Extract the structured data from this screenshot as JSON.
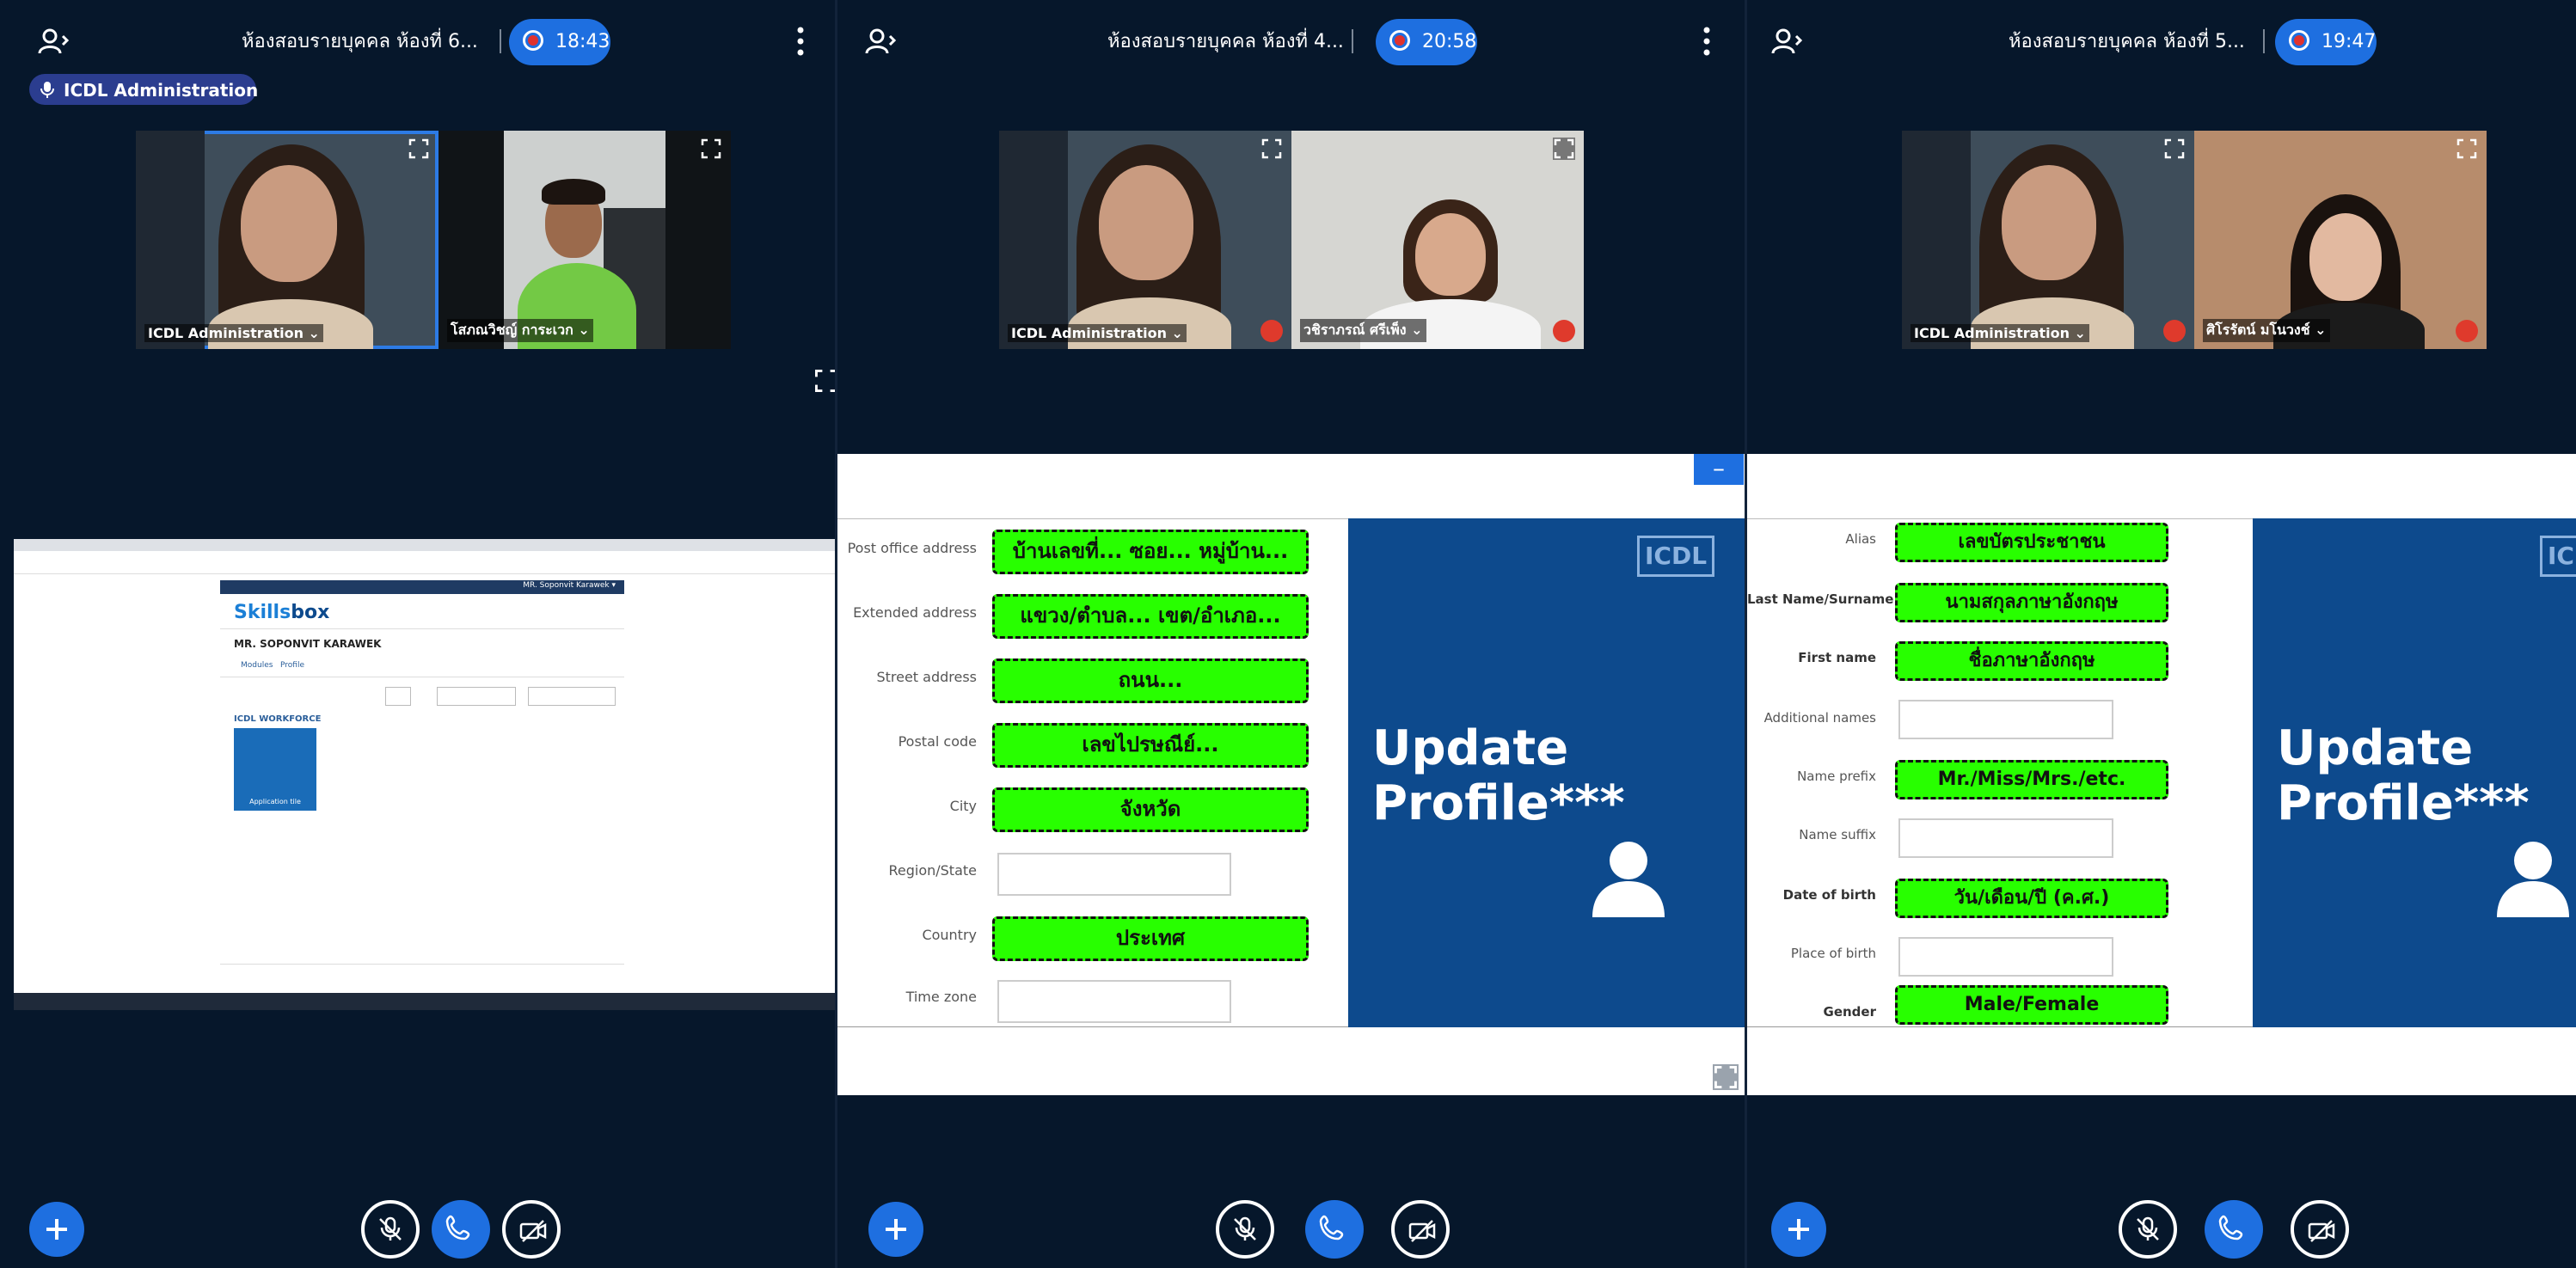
{
  "panels": [
    {
      "title": "ห้องสอบรายบุคคล ห้องที่ 6...",
      "recording_time": "18:43",
      "talking_indicator": "ICDL Administration",
      "videos": [
        {
          "name": "ICDL Administration ⌄"
        },
        {
          "name": "โสภณวิชญ์ การะเวก ⌄"
        }
      ],
      "screenshare": {
        "header_user": "MR. Soponvit Karawek ▾",
        "logo_a": "Skills",
        "logo_b": "box",
        "username": "MR. SOPONVIT KARAWEK",
        "nav": [
          "Modules",
          "Profile"
        ],
        "section": "ICDL WORKFORCE",
        "tile_label": "Application tile"
      }
    },
    {
      "title": "ห้องสอบรายบุคคล ห้องที่ 4...",
      "recording_time": "20:58",
      "videos": [
        {
          "name": "ICDL Administration ⌄"
        },
        {
          "name": "วชิราภรณ์ ศรีเพ็ง ⌄"
        }
      ],
      "slide": {
        "rows": [
          {
            "label": "Post office address",
            "value": "บ้านเลขที่... ซอย... หมู่บ้าน..."
          },
          {
            "label": "Extended address",
            "value": "แขวง/ตำบล... เขต/อำเภอ..."
          },
          {
            "label": "Street address",
            "value": "ถนน..."
          },
          {
            "label": "Postal code",
            "value": "เลขไปรษณีย์..."
          },
          {
            "label": "City",
            "value": "จังหวัด"
          },
          {
            "label": "Region/State",
            "value": ""
          },
          {
            "label": "Country",
            "value": "ประเทศ"
          },
          {
            "label": "Time zone",
            "value": ""
          }
        ],
        "headline_1": "Update",
        "headline_2": "Profile***",
        "logo": "ICDL",
        "minimize": "–"
      }
    },
    {
      "title": "ห้องสอบรายบุคคล ห้องที่ 5...",
      "recording_time": "19:47",
      "videos": [
        {
          "name": "ICDL Administration ⌄"
        },
        {
          "name": "ศิโรรัตน์ มโนวงช์ ⌄"
        }
      ],
      "slide": {
        "rows": [
          {
            "label": "Alias",
            "value": "เลขบัตรประชาชน"
          },
          {
            "label": "Last Name/Surname",
            "value": "นามสกุลภาษาอังกฤษ"
          },
          {
            "label": "First name",
            "value": "ชื่อภาษาอังกฤษ"
          },
          {
            "label": "Additional names",
            "value": ""
          },
          {
            "label": "Name prefix",
            "value": "Mr./Miss/Mrs./etc."
          },
          {
            "label": "Name suffix",
            "value": ""
          },
          {
            "label": "Date of birth",
            "value": "วัน/เดือน/ปี (ค.ศ.)"
          },
          {
            "label": "Place of birth",
            "value": ""
          },
          {
            "label": "Gender",
            "value": "Male/Female"
          }
        ],
        "headline_1": "Update",
        "headline_2": "Profile***",
        "logo": "ICDL"
      }
    }
  ],
  "icons": [
    "users-icon",
    "kebab-menu-icon",
    "microphone-icon",
    "fullscreen-icon",
    "mic-muted-icon",
    "phone-icon",
    "camera-off-icon",
    "plus-icon",
    "person-icon"
  ],
  "colors": {
    "background": "#06172b",
    "accent": "#1e6fe0",
    "highlight": "#28ff00",
    "slide_blue": "#0d4a8d",
    "muted": "#df3a2c"
  }
}
